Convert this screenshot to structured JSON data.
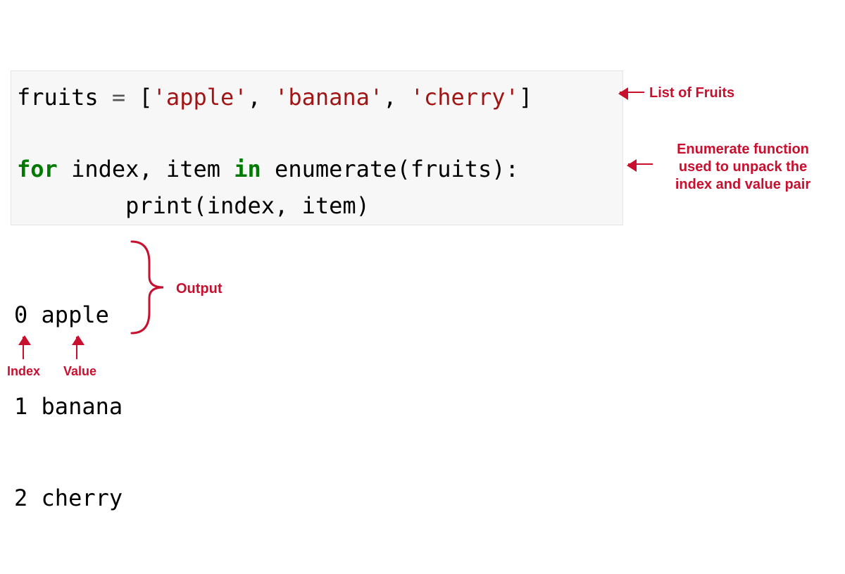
{
  "code": {
    "line1": {
      "var": "fruits",
      "assign": " = ",
      "open": "[",
      "s1": "'apple'",
      "c1": ", ",
      "s2": "'banana'",
      "c2": ", ",
      "s3": "'cherry'",
      "close": "]"
    },
    "blank": " ",
    "line3": {
      "for": "for",
      "sp1": " ",
      "idx": "index",
      "comma": ", ",
      "item": "item",
      "sp2": " ",
      "in": "in",
      "sp3": " ",
      "enum": "enumerate",
      "open": "(",
      "arg": "fruits",
      "close": "):"
    },
    "line4": {
      "indent": "        ",
      "print": "print",
      "open": "(",
      "a1": "index",
      "comma": ", ",
      "a2": "item",
      "close": ")"
    }
  },
  "output": {
    "l1": "0 apple",
    "l2": "1 banana",
    "l3": "2 cherry"
  },
  "annotations": {
    "list_of_fruits": "List of Fruits",
    "enumerate_desc": "Enumerate function used to unpack the index and value pair",
    "output_label": "Output",
    "index_label": "Index",
    "value_label": "Value"
  },
  "colors": {
    "accent": "#c8102e",
    "code_bg": "#f7f7f7",
    "string": "#a31515",
    "keyword": "#007a00"
  }
}
